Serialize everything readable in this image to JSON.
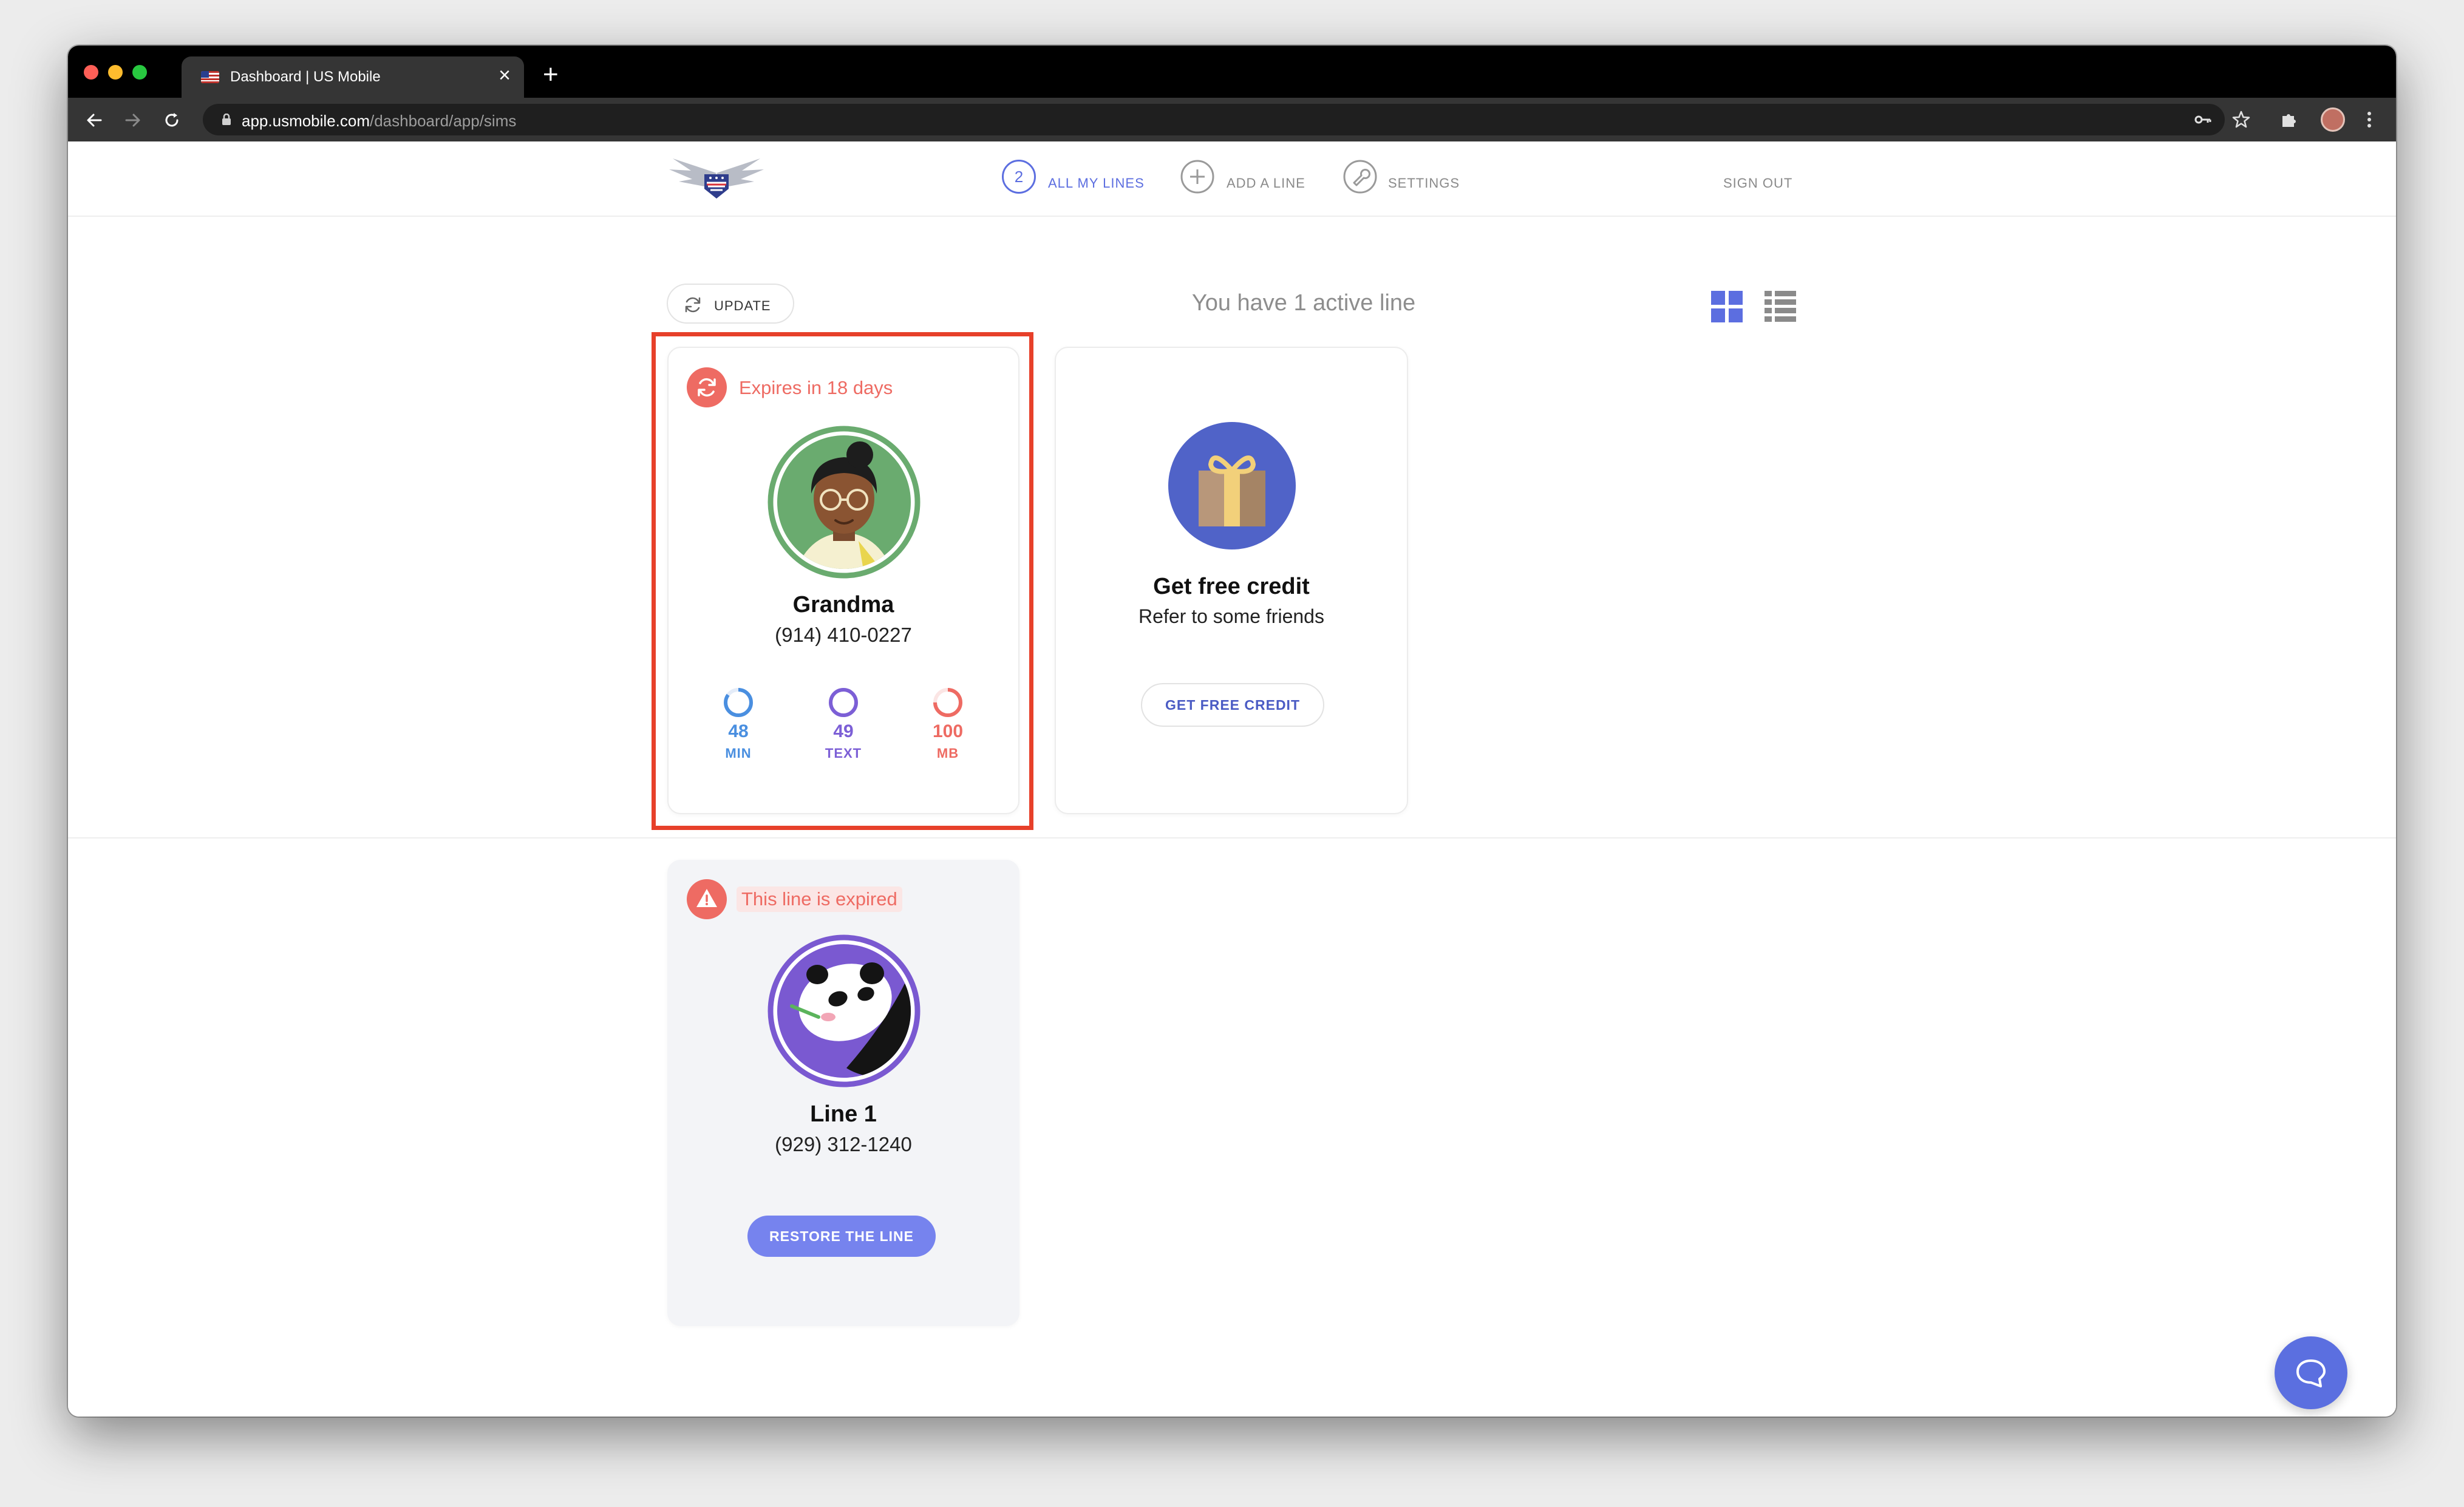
{
  "browser": {
    "tab_title": "Dashboard | US Mobile",
    "url_host": "app.usmobile.com",
    "url_path": "/dashboard/app/sims"
  },
  "nav": {
    "all_lines_count": "2",
    "all_lines_label": "ALL MY LINES",
    "add_line_label": "ADD A LINE",
    "settings_label": "SETTINGS",
    "sign_out_label": "SIGN OUT"
  },
  "toolbar": {
    "update_label": "UPDATE",
    "active_lines_text": "You have 1 active line"
  },
  "lines": [
    {
      "status_text": "Expires in 18 days",
      "name": "Grandma",
      "phone": "(914) 410-0227",
      "usage": [
        {
          "value": "48",
          "unit": "MIN",
          "color": "#4a8fe0",
          "fraction": 0.85
        },
        {
          "value": "49",
          "unit": "TEXT",
          "color": "#7c5fd6",
          "fraction": 1.0
        },
        {
          "value": "100",
          "unit": "MB",
          "color": "#ee6b63",
          "fraction": 0.75
        }
      ]
    },
    {
      "status_text": "This line is expired",
      "name": "Line 1",
      "phone": "(929) 312-1240",
      "action_label": "RESTORE THE LINE"
    }
  ],
  "promo": {
    "title": "Get free credit",
    "subtitle": "Refer to some friends",
    "button_label": "GET FREE CREDIT"
  },
  "colors": {
    "accent": "#5c6ee0",
    "warning": "#ee6b63",
    "highlight": "#e7402a"
  }
}
